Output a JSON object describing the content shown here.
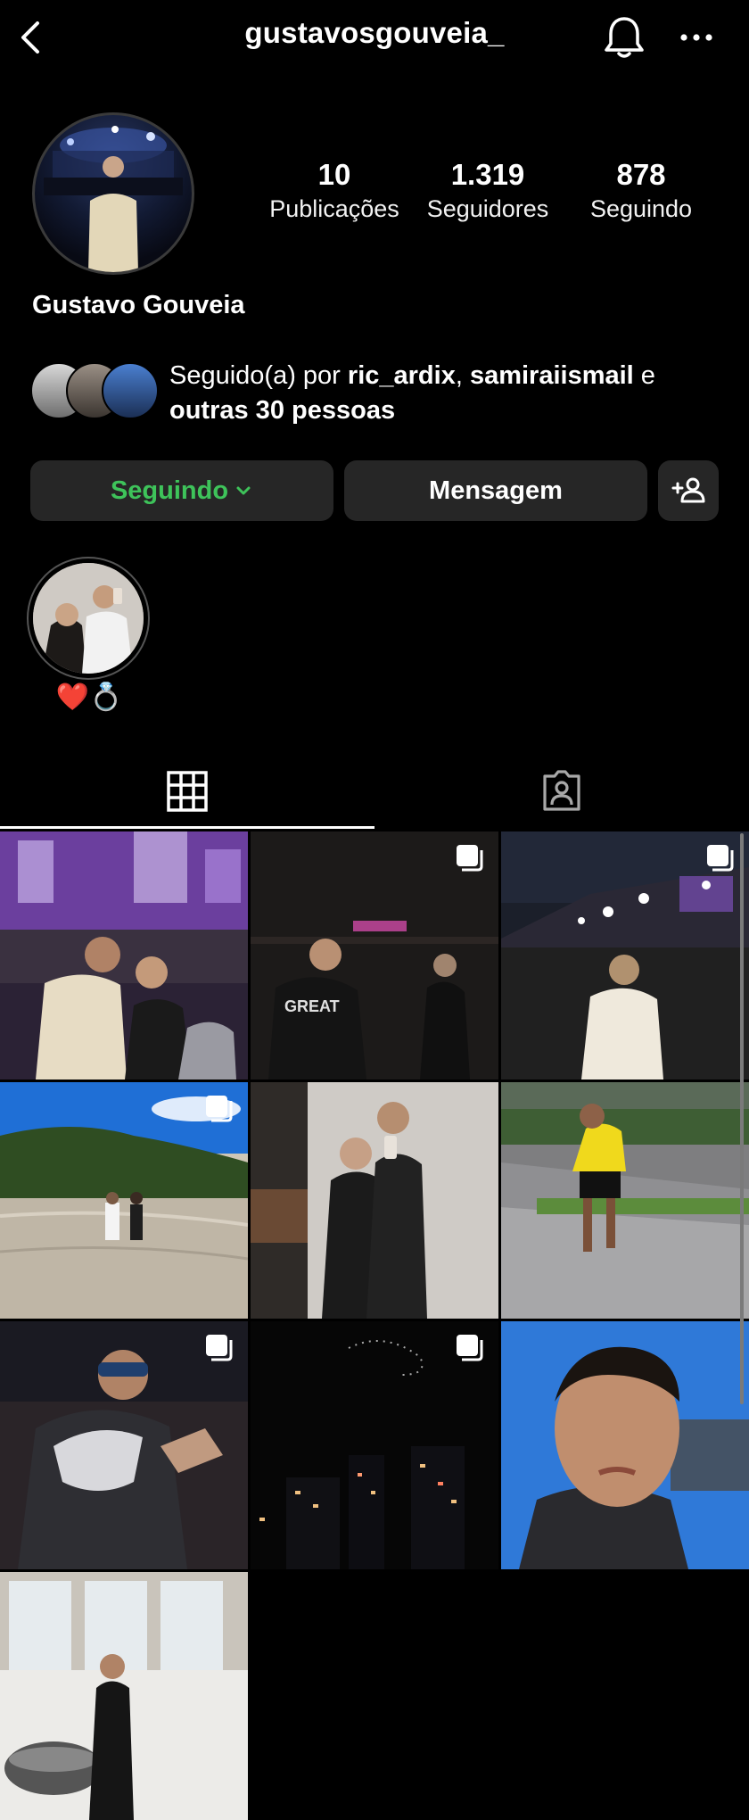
{
  "header": {
    "username": "gustavosgouveia_",
    "back_icon": "chevron-left-icon",
    "bell_icon": "bell-icon",
    "more_icon": "more-horizontal-icon"
  },
  "profile": {
    "full_name": "Gustavo Gouveia",
    "stats": [
      {
        "value": "10",
        "label": "Publicações"
      },
      {
        "value": "1.319",
        "label": "Seguidores"
      },
      {
        "value": "878",
        "label": "Seguindo"
      }
    ],
    "followed_by": {
      "prefix": "Seguido(a) por ",
      "user1": "ric_ardix",
      "sep": ", ",
      "user2": "samiraiismail",
      "conj": " e",
      "others": "outras 30 pessoas"
    }
  },
  "buttons": {
    "following": "Seguindo",
    "message": "Mensagem",
    "following_color": "#3ec35a"
  },
  "highlight": {
    "label": "❤️💍"
  },
  "tabs": {
    "grid_icon": "grid-icon",
    "tagged_icon": "tagged-person-icon"
  }
}
